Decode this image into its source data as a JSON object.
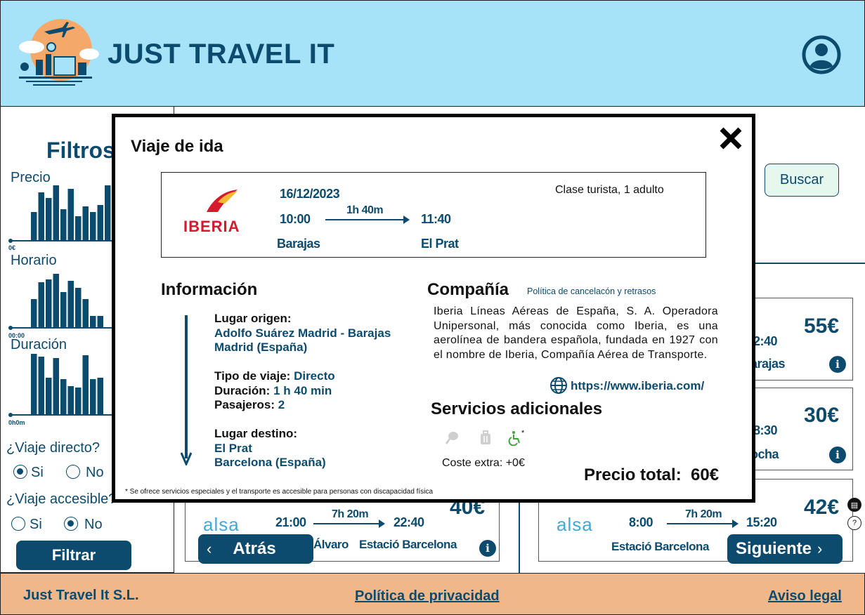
{
  "header": {
    "brand": "JUST TRAVEL IT"
  },
  "sidebar": {
    "title": "Filtros",
    "precio_label": "Precio",
    "precio_min": "0€",
    "horario_label": "Horario",
    "horario_min": "00:00",
    "duracion_label": "Duración",
    "duracion_min": "0h0m",
    "directo_question": "¿Viaje directo?",
    "directo_options": [
      "Si",
      "No"
    ],
    "directo_selected": "Si",
    "accesible_question": "¿Viaje accesible?",
    "accesible_options": [
      "Si",
      "No"
    ],
    "accesible_selected": "No",
    "filter_button": "Filtrar"
  },
  "main": {
    "search_button": "Buscar",
    "result_cards": [
      {
        "price": "55€",
        "time": "2:40",
        "station": "arajas"
      },
      {
        "price": "30€",
        "time": "8:30",
        "station": "ocha"
      },
      {
        "carrier": "alsa",
        "depart": "21:00",
        "duration": "7h 20m",
        "arrive": "22:40",
        "origin": "Álvaro",
        "destination": "Estació Barcelona",
        "price": "40€"
      },
      {
        "carrier": "alsa",
        "depart": "8:00",
        "duration": "7h 20m",
        "arrive": "15:20",
        "origin": "Estació Barcelona",
        "price": "42€"
      }
    ],
    "back_button": "Atrás",
    "next_button": "Siguiente"
  },
  "modal": {
    "title": "Viaje de ida",
    "flight": {
      "airline": "IBERIA",
      "date": "16/12/2023",
      "depart_time": "10:00",
      "duration": "1h 40m",
      "arrive_time": "11:40",
      "origin": "Barajas",
      "destination": "El Prat",
      "class_info": "Clase turista, 1 adulto"
    },
    "info": {
      "title": "Información",
      "origin_label": "Lugar origen:",
      "origin_line1": "Adolfo Suárez Madrid - Barajas",
      "origin_line2": "Madrid (España)",
      "trip_type_label": "Tipo de viaje:",
      "trip_type_value": "Directo",
      "duration_label": "Duración:",
      "duration_value": "1 h 40 min",
      "passengers_label": "Pasajeros:",
      "passengers_value": "2",
      "dest_label": "Lugar destino:",
      "dest_line1": "El Prat",
      "dest_line2": "Barcelona (España)"
    },
    "company": {
      "title": "Compañía",
      "policy_link": "Política de cancelacón y retrasos",
      "description": "Iberia Líneas Aéreas de España, S. A. Operadora Unipersonal, más conocida como Iberia, es una aerolínea de bandera española, fundada en 1927 con el nombre de Iberia, Compañía Aérea de Transporte.",
      "website": "https://www.iberia.com/"
    },
    "services": {
      "title": "Servicios adicionales",
      "extra_cost": "Coste extra: +0€",
      "accessible_mark": "*"
    },
    "total_label": "Precio total:",
    "total_value": "60€",
    "footnote": "* Se ofrece servicios especiales y el transporte es accesible para personas con discapacidad física"
  },
  "footer": {
    "company": "Just Travel It S.L.",
    "privacy": "Política de privacidad",
    "legal": "Aviso legal"
  },
  "colors": {
    "primary": "#0c4b6e",
    "header_bg": "#a7e3f8",
    "footer_bg": "#f0b88a",
    "iberia_red": "#d7192d",
    "accessible_green": "#3ea63e"
  },
  "histograms": {
    "precio": [
      40,
      68,
      60,
      78,
      44,
      73,
      34,
      48,
      40,
      50,
      78
    ],
    "horario": [
      40,
      64,
      68,
      76,
      50,
      66,
      56,
      40,
      16,
      16
    ],
    "duracion": [
      86,
      82,
      52,
      80,
      50,
      40,
      38,
      84,
      50,
      52
    ]
  }
}
